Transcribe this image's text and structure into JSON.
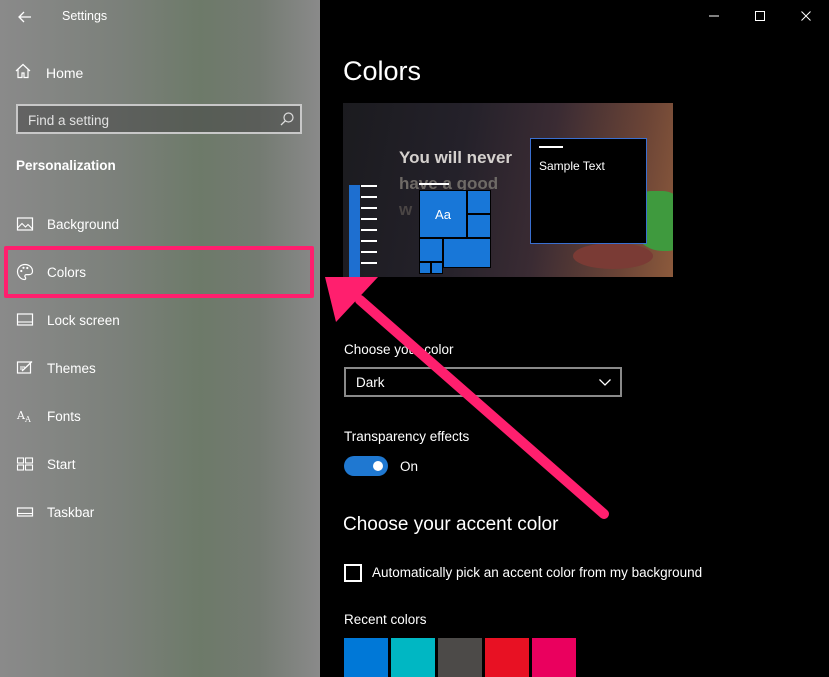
{
  "window": {
    "title": "Settings",
    "controls": {
      "minimize": "minimize-icon",
      "maximize": "maximize-icon",
      "close": "close-icon"
    }
  },
  "sidebar": {
    "home_label": "Home",
    "search_placeholder": "Find a setting",
    "section": "Personalization",
    "items": [
      {
        "label": "Background",
        "icon": "picture-icon"
      },
      {
        "label": "Colors",
        "icon": "palette-icon"
      },
      {
        "label": "Lock screen",
        "icon": "lock-screen-icon"
      },
      {
        "label": "Themes",
        "icon": "themes-icon"
      },
      {
        "label": "Fonts",
        "icon": "fonts-icon"
      },
      {
        "label": "Start",
        "icon": "start-icon"
      },
      {
        "label": "Taskbar",
        "icon": "taskbar-icon"
      }
    ],
    "selected": "Colors"
  },
  "main": {
    "title": "Colors",
    "preview": {
      "wallpaper_text": [
        "You will never",
        "have a good",
        "w"
      ],
      "tile_label": "Aa",
      "sample_text": "Sample Text"
    },
    "choose_color_label": "Choose your color",
    "choose_color_value": "Dark",
    "transparency_label": "Transparency effects",
    "transparency_state": "On",
    "accent_heading": "Choose your accent color",
    "auto_accent_label": "Automatically pick an accent color from my background",
    "auto_accent_checked": false,
    "recent_label": "Recent colors",
    "recent_colors": [
      "#0078d7",
      "#00b7c3",
      "#4c4a48",
      "#e81123",
      "#ea005e"
    ]
  },
  "annotation": {
    "highlight_color": "#ff1f6e"
  }
}
